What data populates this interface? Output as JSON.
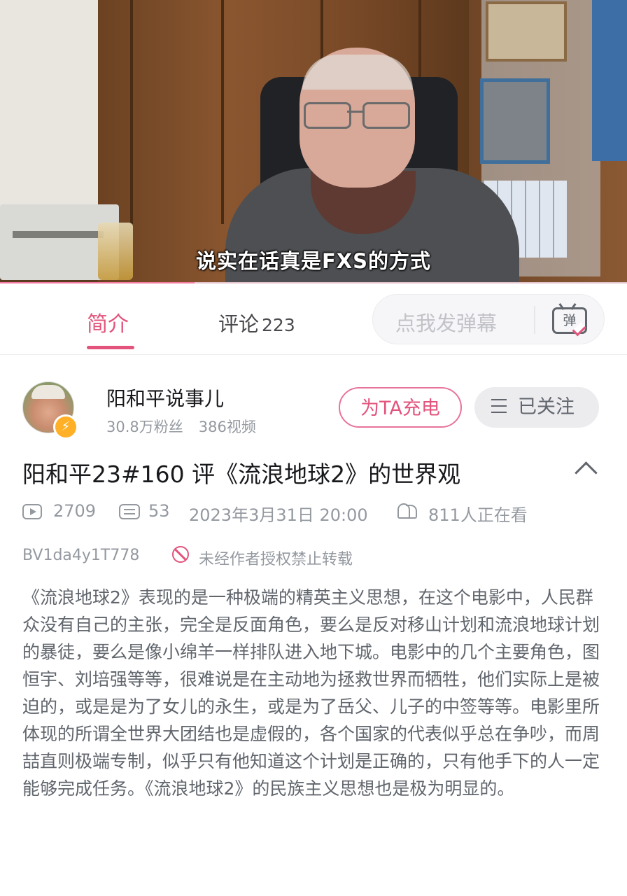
{
  "video": {
    "subtitle": "说实在话真是FXS的方式",
    "progress_fraction": 0.31
  },
  "tabs": {
    "intro_label": "简介",
    "comments_label": "评论",
    "comments_count": "223",
    "danmu_placeholder": "点我发弹幕",
    "danmu_button_label": "弹"
  },
  "uploader": {
    "name": "阳和平说事儿",
    "fans": "30.8万粉丝",
    "videos": "386视频",
    "charge_label": "为TA充电",
    "follow_label": "已关注"
  },
  "video_info": {
    "title": "阳和平23#160 评《流浪地球2》的世界观",
    "plays": "2709",
    "danmaku": "53",
    "publish_time": "2023年3月31日 20:00",
    "watching": "811人正在看",
    "bvid": "BV1da4y1T778",
    "copyright_notice": "未经作者授权禁止转载",
    "description": "《流浪地球2》表现的是一种极端的精英主义思想，在这个电影中，人民群众没有自己的主张，完全是反面角色，要么是反对移山计划和流浪地球计划的暴徒，要么是像小绵羊一样排队进入地下城。电影中的几个主要角色，图恒宇、刘培强等等，很难说是在主动地为拯救世界而牺牲，他们实际上是被迫的，或是是为了女儿的永生，或是为了岳父、儿子的中签等等。电影里所体现的所谓全世界大团结也是虚假的，各个国家的代表似乎总在争吵，而周喆直则极端专制，似乎只有他知道这个计划是正确的，只有他手下的人一定能够完成任务。《流浪地球2》的民族主义思想也是极为明显的。"
  },
  "colors": {
    "accent": "#e2547c",
    "muted": "#9499a0"
  }
}
